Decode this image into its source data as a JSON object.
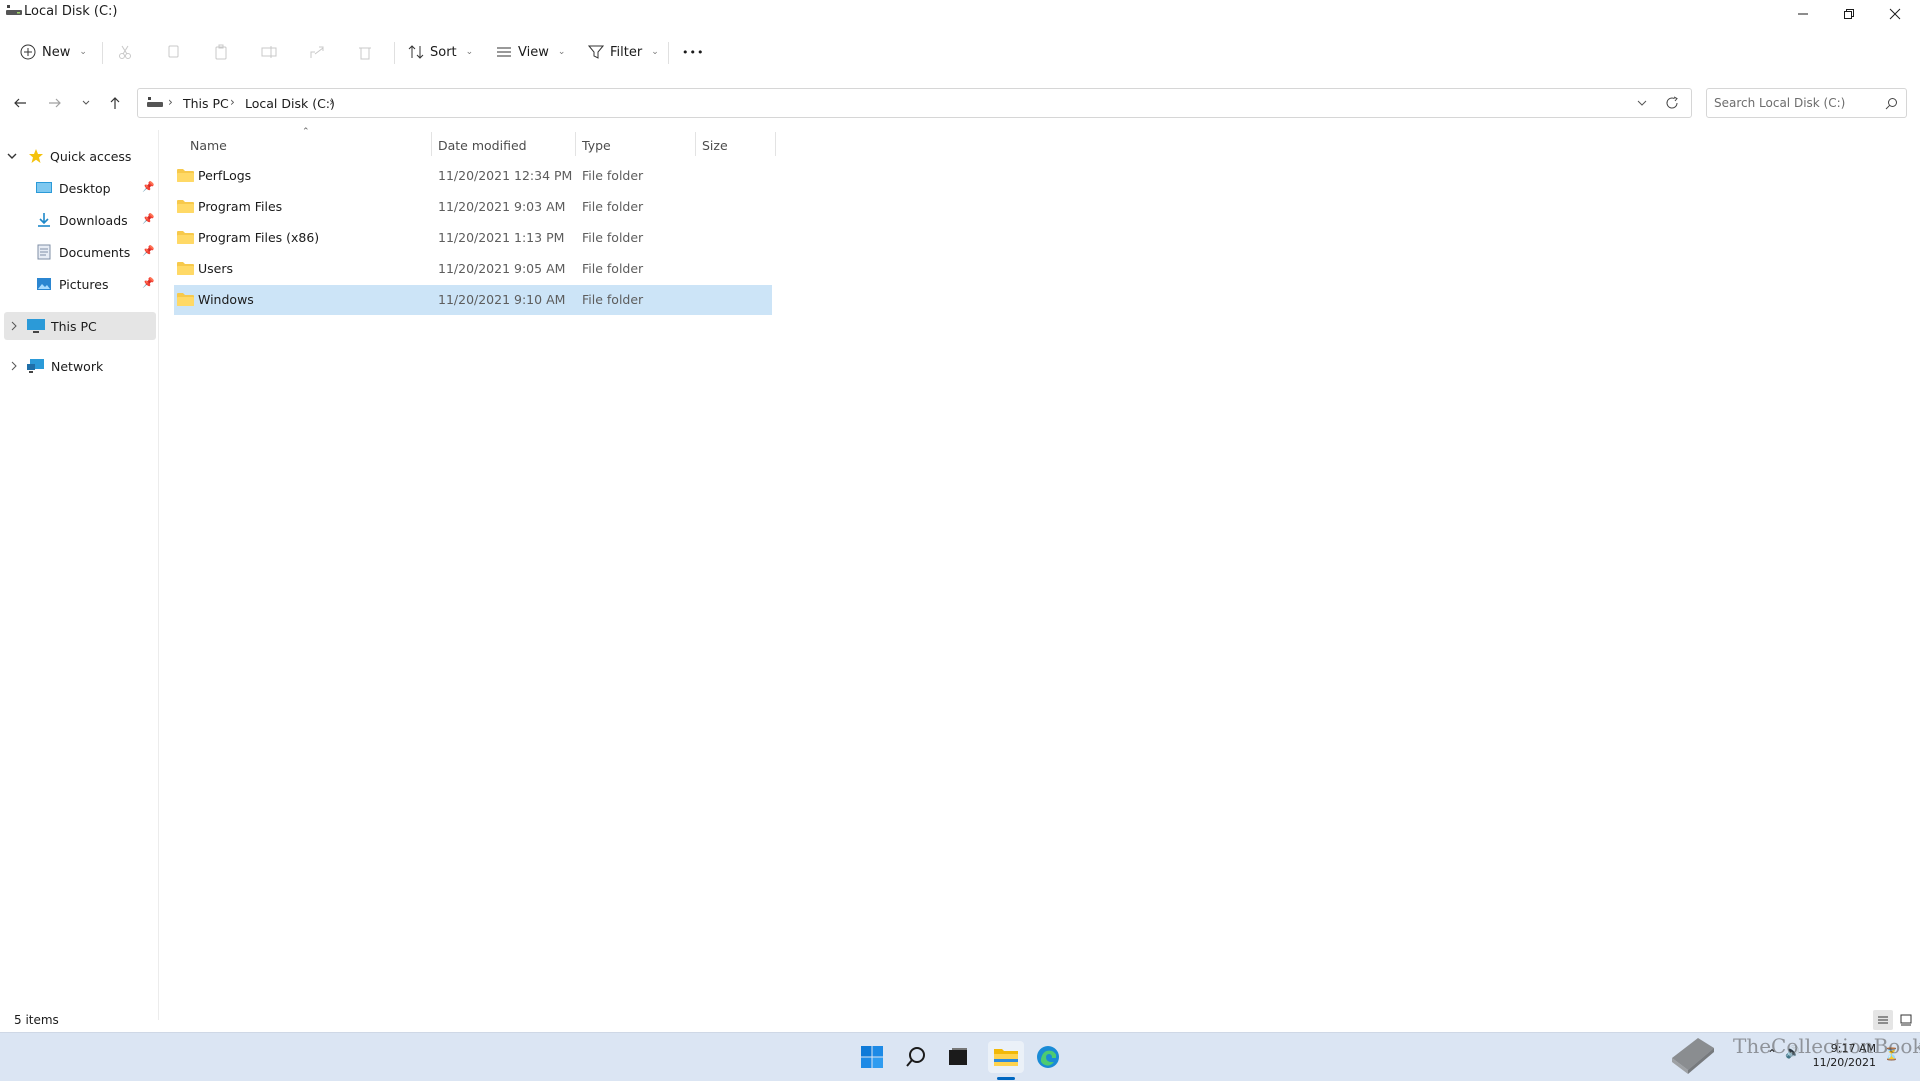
{
  "window": {
    "title": "Local Disk (C:)"
  },
  "commands": {
    "new_label": "New",
    "sort_label": "Sort",
    "view_label": "View",
    "filter_label": "Filter",
    "more_label": "•••"
  },
  "address": {
    "crumbs": [
      "This PC",
      "Local Disk (C:)"
    ],
    "search_placeholder": "Search Local Disk (C:)"
  },
  "nav": {
    "quick_access": "Quick access",
    "items": [
      {
        "label": "Desktop",
        "icon": "desktop-icon",
        "pinned": true
      },
      {
        "label": "Downloads",
        "icon": "downloads-icon",
        "pinned": true
      },
      {
        "label": "Documents",
        "icon": "documents-icon",
        "pinned": true
      },
      {
        "label": "Pictures",
        "icon": "pictures-icon",
        "pinned": true
      }
    ],
    "this_pc": "This PC",
    "network": "Network"
  },
  "columns": {
    "name": "Name",
    "date": "Date modified",
    "type": "Type",
    "size": "Size"
  },
  "files": [
    {
      "name": "PerfLogs",
      "date": "11/20/2021 12:34 PM",
      "type": "File folder"
    },
    {
      "name": "Program Files",
      "date": "11/20/2021 9:03 AM",
      "type": "File folder"
    },
    {
      "name": "Program Files (x86)",
      "date": "11/20/2021 1:13 PM",
      "type": "File folder"
    },
    {
      "name": "Users",
      "date": "11/20/2021 9:05 AM",
      "type": "File folder"
    },
    {
      "name": "Windows",
      "date": "11/20/2021 9:10 AM",
      "type": "File folder",
      "selected": true
    }
  ],
  "status": {
    "item_count": "5 items"
  },
  "taskbar": {
    "time": "9:17 AM",
    "date": "11/20/2021"
  },
  "watermark": "TheCollectionBook",
  "colors": {
    "selection": "#cce4f7",
    "taskbar": "#dbe5f3",
    "accent": "#0067c0"
  }
}
